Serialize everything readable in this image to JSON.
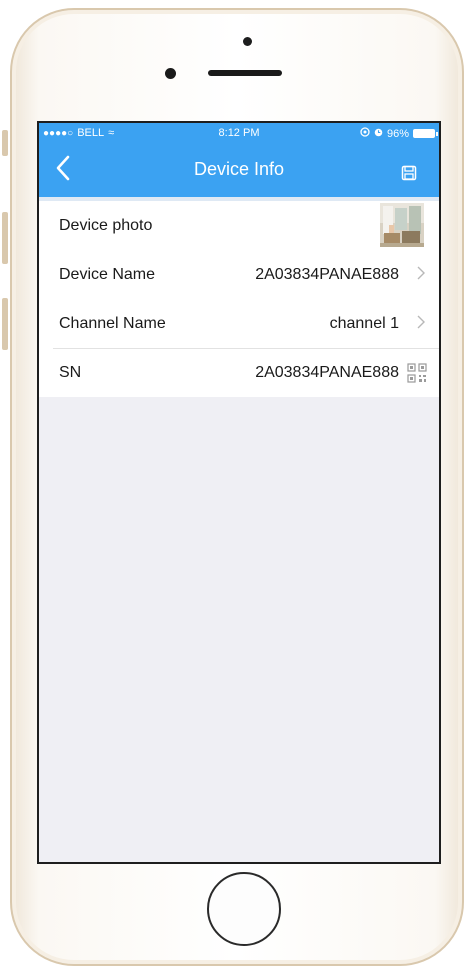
{
  "status_bar": {
    "signal": "●●●●○",
    "carrier": "BELL",
    "wifi": "≈",
    "time": "8:12 PM",
    "battery_pct": "96%"
  },
  "nav": {
    "title": "Device Info"
  },
  "rows": [
    {
      "label": "Device photo"
    },
    {
      "label": "Device Name",
      "value": "2A03834PANAE888"
    },
    {
      "label": "Channel Name",
      "value": "channel 1"
    },
    {
      "label": "SN",
      "value": "2A03834PANAE888"
    }
  ],
  "colors": {
    "header": "#3ba2f2",
    "background": "#efeff4",
    "chevron": "#b8b8b8"
  },
  "icons": {
    "back": "chevron-left-icon",
    "save": "floppy-disk-icon",
    "qr": "qr-code-icon",
    "chevron": "chevron-right-icon"
  }
}
